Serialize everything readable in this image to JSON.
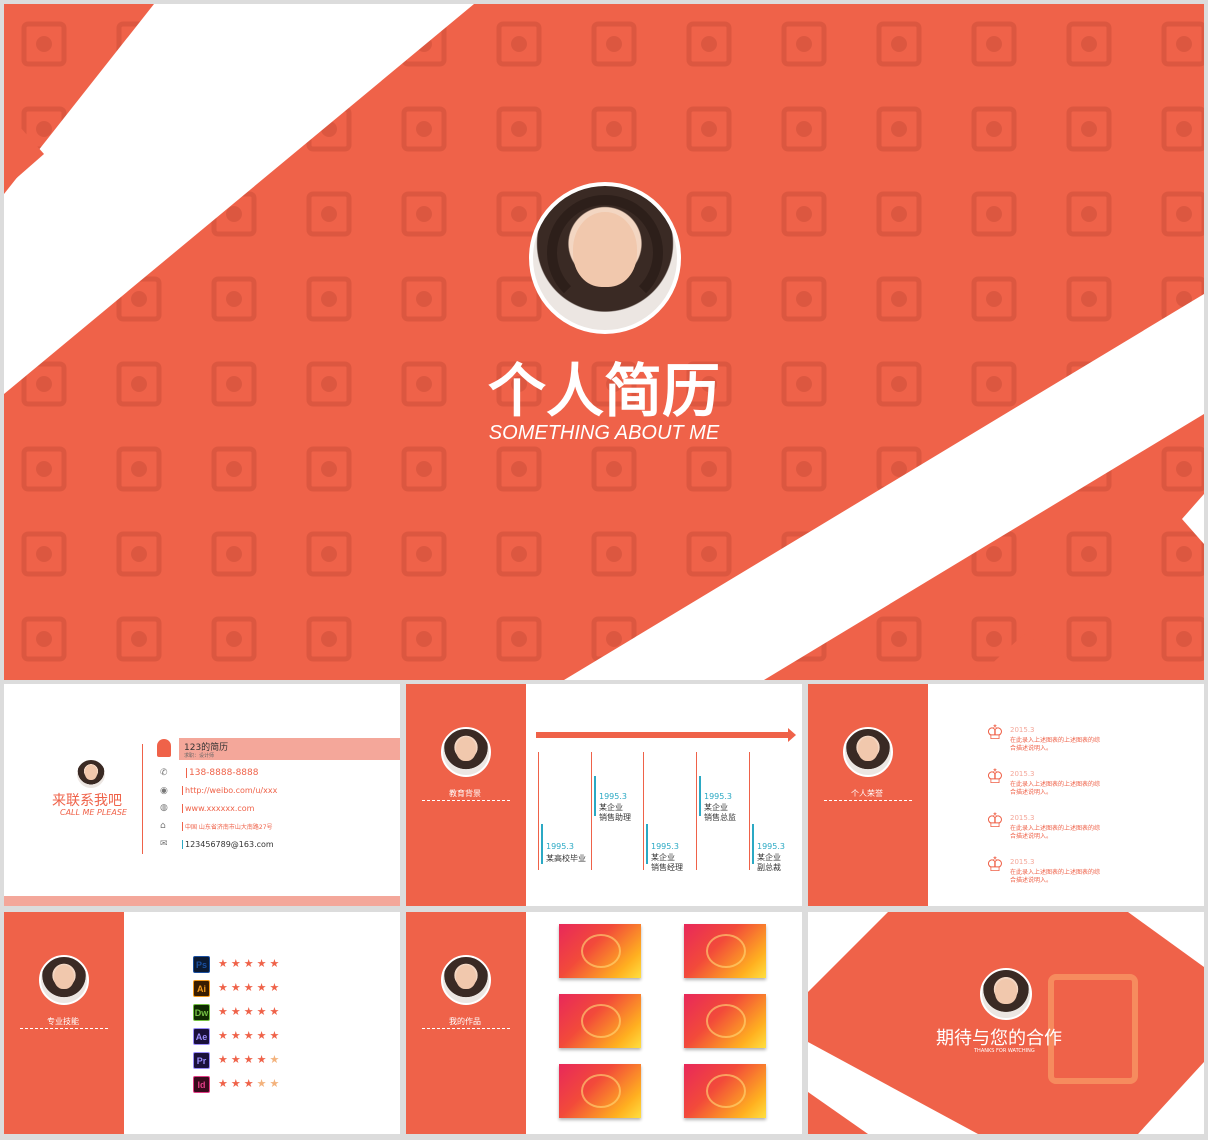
{
  "main": {
    "title_cn": "个人简历",
    "title_en": "SOMETHING ABOUT ME"
  },
  "contact": {
    "title_cn": "来联系我吧",
    "title_en": "CALL ME PLEASE",
    "name": "123的简历",
    "role": "求职：设计师",
    "phone": "138-8888-8888",
    "weibo": "http://weibo.com/u/xxx",
    "site": "www.xxxxxx.com",
    "address": "中国 山东省济南市山大南路27号",
    "email": "123456789@163.com"
  },
  "education": {
    "label": "教育背景",
    "items": [
      {
        "date": "1995.3",
        "l1": "某高校毕业",
        "l2": ""
      },
      {
        "date": "1995.3",
        "l1": "某企业",
        "l2": "销售助理"
      },
      {
        "date": "1995.3",
        "l1": "某企业",
        "l2": "销售经理"
      },
      {
        "date": "1995.3",
        "l1": "某企业",
        "l2": "销售总监"
      },
      {
        "date": "1995.3",
        "l1": "某企业",
        "l2": "副总裁"
      }
    ]
  },
  "honors": {
    "label": "个人荣誉",
    "items": [
      {
        "date": "2015.3",
        "text1": "在此录入上述图表的上述图表的综",
        "text2": "合描述说明入。"
      },
      {
        "date": "2015.3",
        "text1": "在此录入上述图表的上述图表的综",
        "text2": "合描述说明入。"
      },
      {
        "date": "2015.3",
        "text1": "在此录入上述图表的上述图表的综",
        "text2": "合描述说明入。"
      },
      {
        "date": "2015.3",
        "text1": "在此录入上述图表的上述图表的综",
        "text2": "合描述说明入。"
      }
    ]
  },
  "skills": {
    "label": "专业技能",
    "items": [
      {
        "abbr": "Ps",
        "color": "#1a4fa0",
        "bg": "#0b1a33",
        "stars": 5
      },
      {
        "abbr": "Ai",
        "color": "#f39a1d",
        "bg": "#3a1d00",
        "stars": 5
      },
      {
        "abbr": "Dw",
        "color": "#74c044",
        "bg": "#0f2a00",
        "stars": 5
      },
      {
        "abbr": "Ae",
        "color": "#9b8dfa",
        "bg": "#1a103b",
        "stars": 5
      },
      {
        "abbr": "Pr",
        "color": "#9b8dfa",
        "bg": "#1a103b",
        "stars": 4
      },
      {
        "abbr": "Id",
        "color": "#e23d86",
        "bg": "#3a0a1c",
        "stars": 3
      }
    ]
  },
  "works": {
    "label": "我的作品"
  },
  "thanks": {
    "title_cn": "期待与您的合作",
    "title_en": "THANKS FOR WATCHING"
  },
  "colors": {
    "accent": "#ef6249",
    "teal": "#2ba9c4"
  }
}
